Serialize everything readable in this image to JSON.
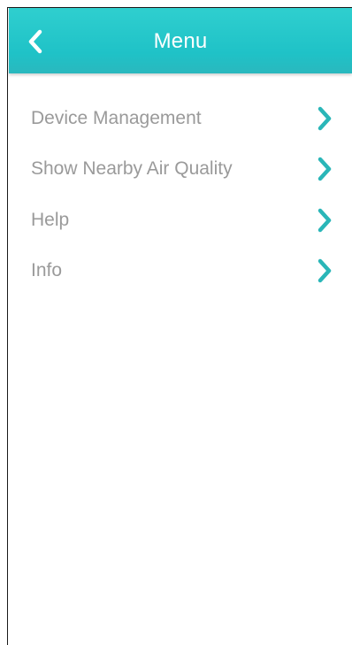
{
  "header": {
    "title": "Menu",
    "back_icon": "chevron-left-icon"
  },
  "menu": {
    "items": [
      {
        "label": "Device Management",
        "icon": "chevron-right-icon"
      },
      {
        "label": "Show Nearby Air Quality",
        "icon": "chevron-right-icon"
      },
      {
        "label": "Help",
        "icon": "chevron-right-icon"
      },
      {
        "label": "Info",
        "icon": "chevron-right-icon"
      }
    ]
  },
  "colors": {
    "header_background": "#1fc2c7",
    "header_text": "#ffffff",
    "menu_text": "#9a9a9a",
    "chevron": "#2ab6b8"
  }
}
